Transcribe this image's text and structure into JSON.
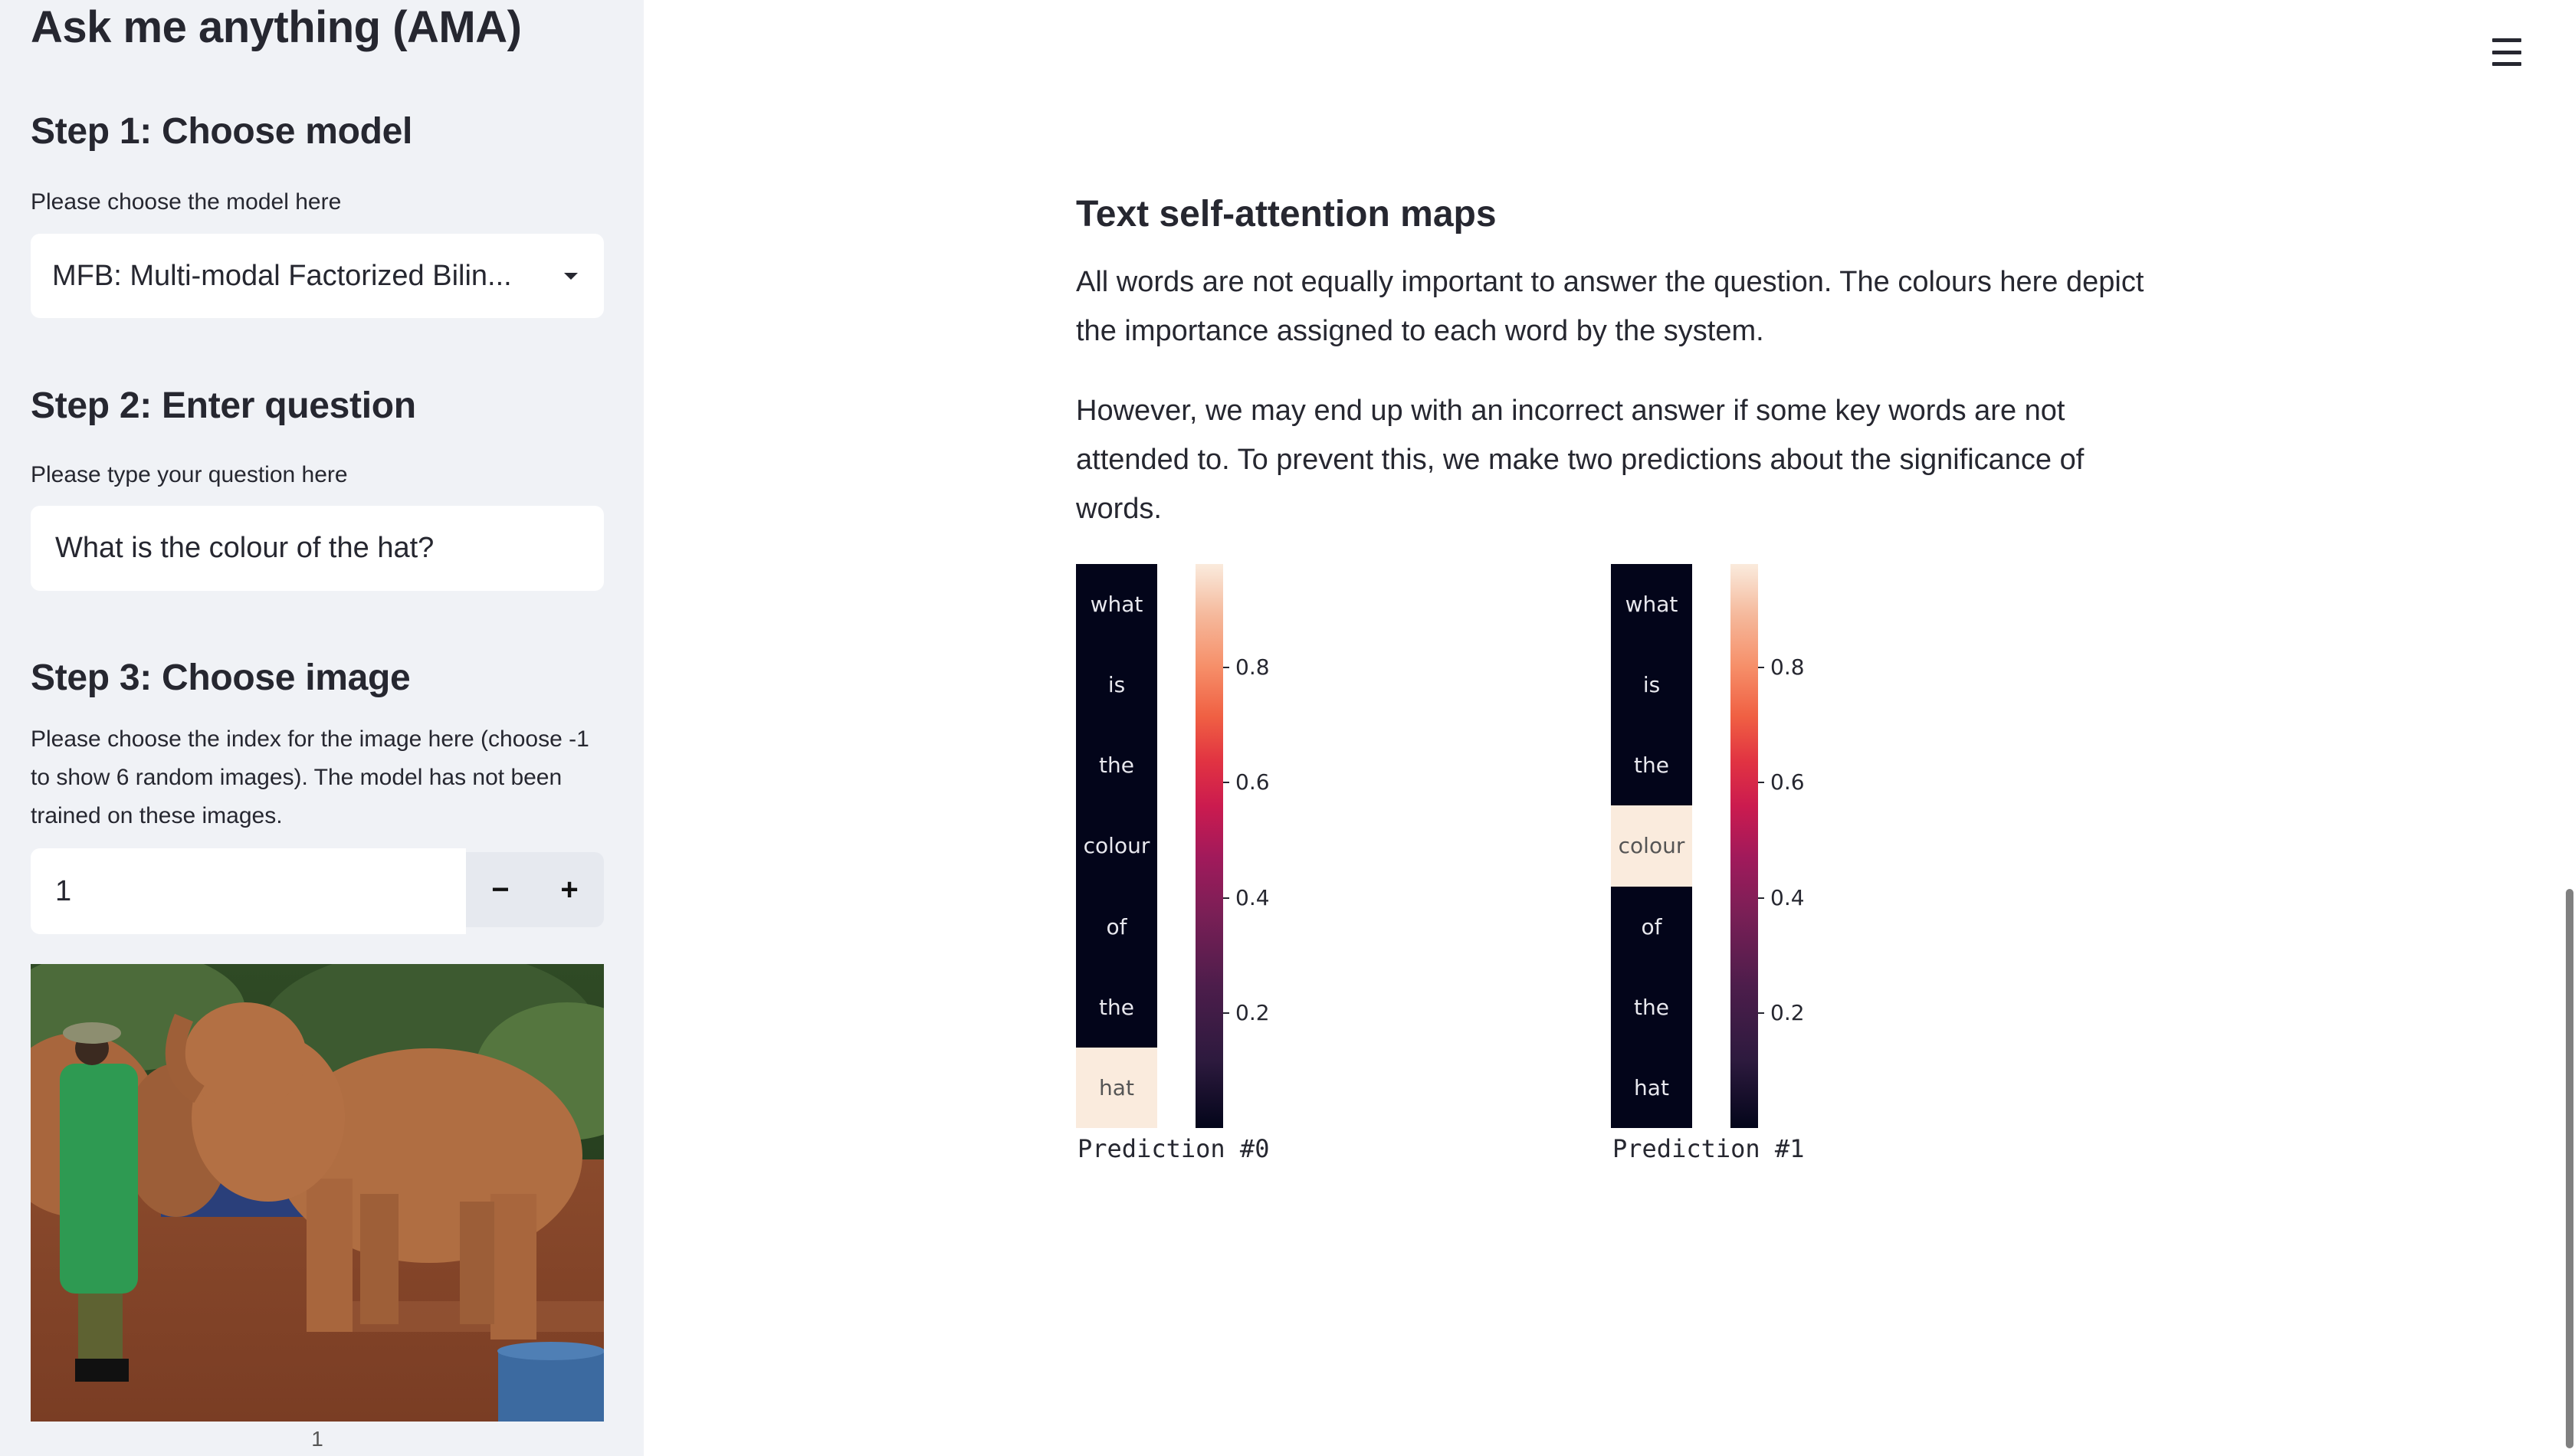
{
  "sidebar": {
    "app_title": "Ask me anything (AMA)",
    "step1": {
      "heading": "Step 1: Choose model",
      "label": "Please choose the model here",
      "selected_model": "MFB: Multi-modal Factorized Bilin..."
    },
    "step2": {
      "heading": "Step 2: Enter question",
      "label": "Please type your question here",
      "question_value": "What is the colour of the hat?"
    },
    "step3": {
      "heading": "Step 3: Choose image",
      "label": "Please choose the index for the image here (choose -1 to show 6 random images). The model has not been trained on these images.",
      "index_value": "1",
      "decrement_label": "−",
      "increment_label": "+",
      "image_description": "Elephant drinking from a bottle next to a keeper in a green coat wearing a hat",
      "image_caption": "1"
    }
  },
  "header": {
    "menu_icon": "hamburger-menu-icon"
  },
  "main": {
    "section_title": "Text self-attention maps",
    "paragraphs": [
      "All words are not equally important to answer the question. The colours here depict the importance assigned to each word by the system.",
      "However, we may end up with an incorrect answer if some key words are not attended to. To prevent this, we make two predictions about the significance of words."
    ]
  },
  "colors": {
    "sidebar_bg": "#f0f2f6",
    "text": "#262730",
    "stepper_bg": "#e6e9ef",
    "heat_low": "#03051a",
    "heat_high": "#faebdd"
  },
  "chart_data": [
    {
      "type": "heatmap",
      "title": "Prediction #0",
      "rows": [
        "what",
        "is",
        "the",
        "colour",
        "of",
        "the",
        "hat"
      ],
      "values": [
        0.0,
        0.0,
        0.0,
        0.0,
        0.0,
        0.0,
        0.98
      ],
      "colorbar": {
        "ticks": [
          0.2,
          0.4,
          0.6,
          0.8
        ],
        "tick_labels": [
          "0.2",
          "0.4",
          "0.6",
          "0.8"
        ],
        "range": [
          0.0,
          0.98
        ],
        "colormap": "rocket"
      }
    },
    {
      "type": "heatmap",
      "title": "Prediction #1",
      "rows": [
        "what",
        "is",
        "the",
        "colour",
        "of",
        "the",
        "hat"
      ],
      "values": [
        0.0,
        0.0,
        0.0,
        0.98,
        0.0,
        0.0,
        0.0
      ],
      "colorbar": {
        "ticks": [
          0.2,
          0.4,
          0.6,
          0.8
        ],
        "tick_labels": [
          "0.2",
          "0.4",
          "0.6",
          "0.8"
        ],
        "range": [
          0.0,
          0.98
        ],
        "colormap": "rocket"
      }
    }
  ]
}
